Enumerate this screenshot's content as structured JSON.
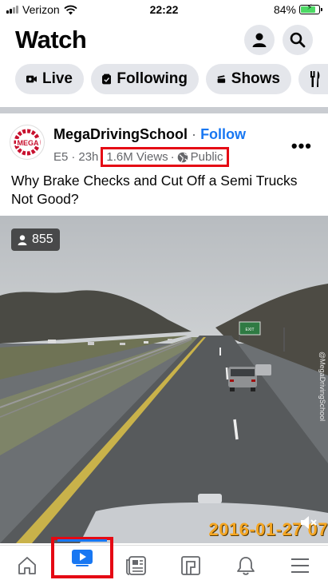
{
  "status_bar": {
    "carrier": "Verizon",
    "time": "22:22",
    "battery": "84%",
    "battery_level": 0.84
  },
  "header": {
    "title": "Watch"
  },
  "chips": [
    {
      "label": "Live",
      "icon": "live-camera-icon"
    },
    {
      "label": "Following",
      "icon": "following-icon"
    },
    {
      "label": "Shows",
      "icon": "clapperboard-icon"
    },
    {
      "label": "",
      "icon": "food-icon"
    }
  ],
  "post": {
    "author": "MegaDrivingSchool",
    "separator": "·",
    "follow_label": "Follow",
    "episode": "E5",
    "age": "23h",
    "views": "1.6M Views",
    "privacy": "Public",
    "more": "•••",
    "title": "Why Brake Checks and Cut Off a Semi Trucks Not Good?",
    "avatar_logo_text": "MEGA"
  },
  "video": {
    "viewers": "855",
    "timestamp": "2016-01-27 07",
    "watermark": "@MegaDrivingSchool",
    "sign_text": "EXIT"
  },
  "tabbar": {
    "tabs": [
      "home-icon",
      "watch-icon",
      "news-icon",
      "marketplace-icon",
      "bell-icon",
      "menu-icon"
    ],
    "active": "watch-icon"
  },
  "colors": {
    "accent": "#1877f2",
    "highlight": "#e50914",
    "timestamp": "#f5a623"
  }
}
